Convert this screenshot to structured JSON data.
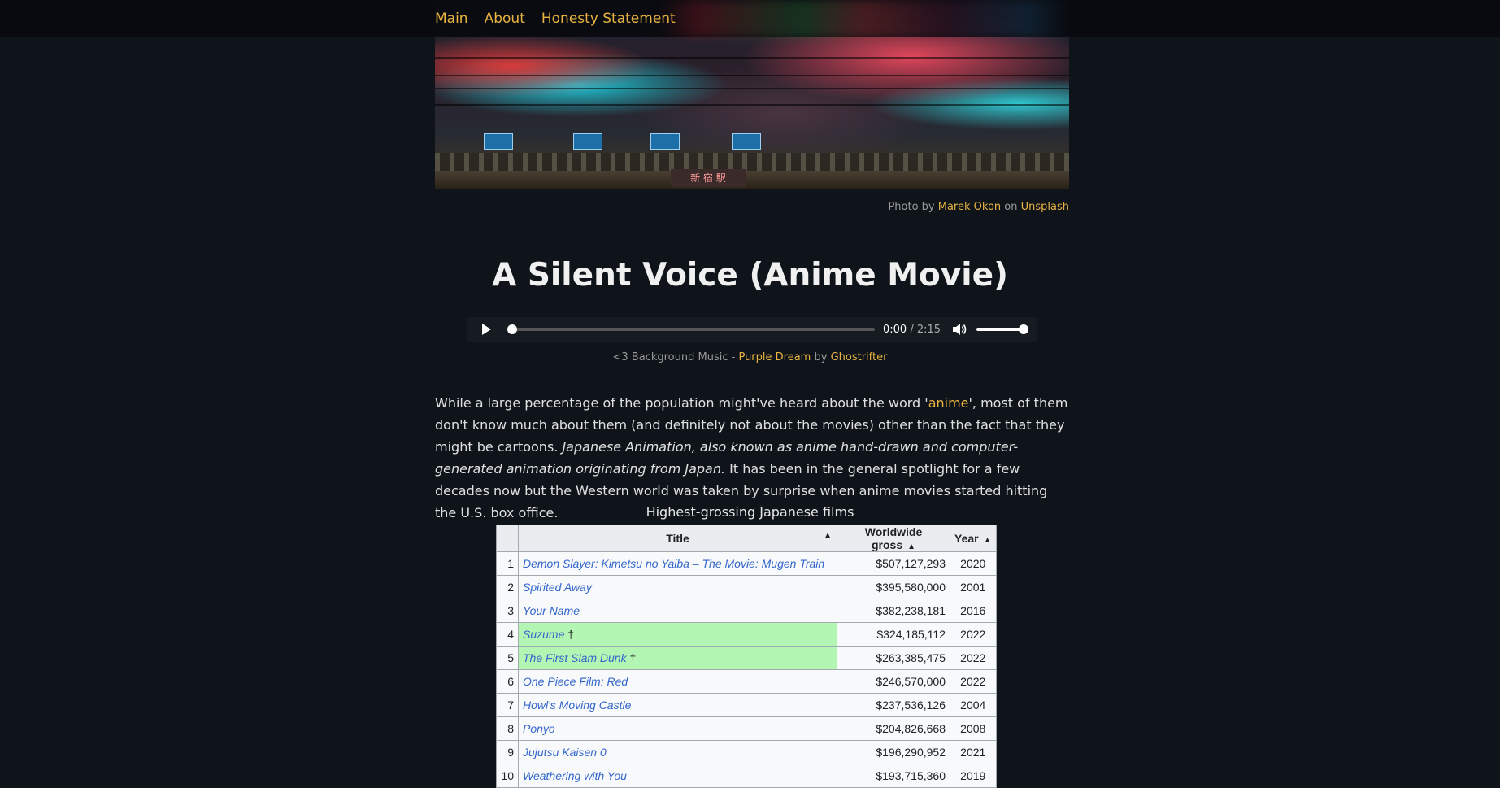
{
  "nav": {
    "items": [
      {
        "label": "Main"
      },
      {
        "label": "About"
      },
      {
        "label": "Honesty Statement"
      }
    ]
  },
  "hero": {
    "station_sign": "新 宿 駅"
  },
  "photo_credit": {
    "prefix": "Photo by",
    "author": "Marek Okon",
    "middle": "on",
    "site": "Unsplash"
  },
  "page": {
    "title": "A Silent Voice (Anime Movie)"
  },
  "player": {
    "current_time": "0:00",
    "separator": "/",
    "duration": "2:15",
    "progress": 0,
    "volume": 1.0
  },
  "music_credit": {
    "prefix": "<3 Background Music -",
    "track": "Purple Dream",
    "middle": "by",
    "artist": "Ghostrifter"
  },
  "intro": {
    "p1": "While a large percentage of the population might've heard about the word '",
    "link": "anime",
    "p2": "', most of them don't know much about them (and definitely not about the movies) other than the fact that they might be cartoons. ",
    "italic": "Japanese Animation, also known as anime hand-drawn and computer-generated animation originating from Japan.",
    "p3": " It has been in the general spotlight for a few decades now but the Western world was taken by surprise when anime movies started hitting the U.S. box office."
  },
  "table": {
    "caption": "Highest-grossing Japanese films",
    "headers": [
      "Title",
      "Worldwide gross",
      "Year"
    ],
    "rows": [
      {
        "rank": "1",
        "title": "Demon Slayer: Kimetsu no Yaiba – The Movie: Mugen Train",
        "gross": "$507,127,293",
        "year": "2020",
        "highlight": false
      },
      {
        "rank": "2",
        "title": "Spirited Away",
        "gross": "$395,580,000",
        "year": "2001",
        "highlight": false
      },
      {
        "rank": "3",
        "title": "Your Name",
        "gross": "$382,238,181",
        "year": "2016",
        "highlight": false
      },
      {
        "rank": "4",
        "title": "Suzume",
        "gross": "$324,185,112",
        "year": "2022",
        "highlight": true
      },
      {
        "rank": "5",
        "title": "The First Slam Dunk",
        "gross": "$263,385,475",
        "year": "2022",
        "highlight": true
      },
      {
        "rank": "6",
        "title": "One Piece Film: Red",
        "gross": "$246,570,000",
        "year": "2022",
        "highlight": false
      },
      {
        "rank": "7",
        "title": "Howl's Moving Castle",
        "gross": "$237,536,126",
        "year": "2004",
        "highlight": false
      },
      {
        "rank": "8",
        "title": "Ponyo",
        "gross": "$204,826,668",
        "year": "2008",
        "highlight": false
      },
      {
        "rank": "9",
        "title": "Jujutsu Kaisen 0",
        "gross": "$196,290,952",
        "year": "2021",
        "highlight": false
      },
      {
        "rank": "10",
        "title": "Weathering with You",
        "gross": "$193,715,360",
        "year": "2019",
        "highlight": false
      }
    ],
    "dagger": "†"
  }
}
